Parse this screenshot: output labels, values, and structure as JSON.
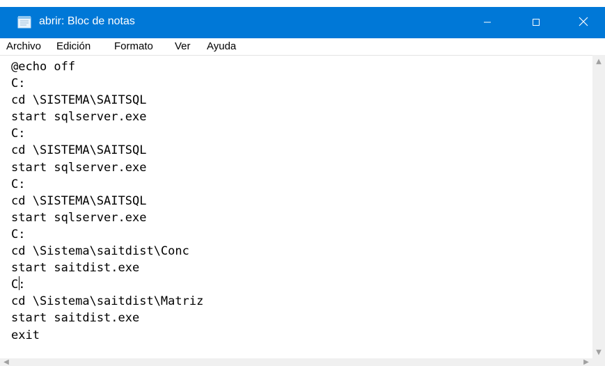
{
  "window": {
    "title": "abrir: Bloc de notas",
    "accent_color": "#0078d7",
    "icon": "notepad-icon"
  },
  "menu": {
    "items": [
      {
        "label": "Archivo"
      },
      {
        "label": "Edición"
      },
      {
        "label": "Formato"
      },
      {
        "label": "Ver"
      },
      {
        "label": "Ayuda"
      }
    ]
  },
  "document": {
    "lines": [
      "@echo off",
      "C:",
      "cd \\SISTEMA\\SAITSQL",
      "start sqlserver.exe",
      "C:",
      "cd \\SISTEMA\\SAITSQL",
      "start sqlserver.exe",
      "C:",
      "cd \\SISTEMA\\SAITSQL",
      "start sqlserver.exe",
      "C:",
      "cd \\Sistema\\saitdist\\Conc",
      "start saitdist.exe",
      "C:",
      "cd \\Sistema\\saitdist\\Matriz",
      "start saitdist.exe",
      "exit"
    ]
  }
}
